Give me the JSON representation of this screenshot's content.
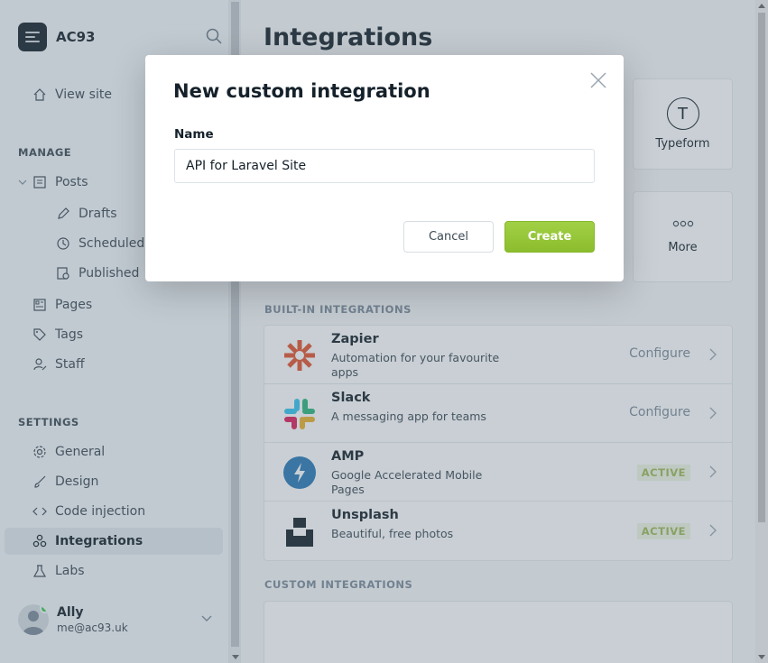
{
  "brand": {
    "name": "AC93"
  },
  "sidebar": {
    "view_site": "View site",
    "manage_label": "MANAGE",
    "posts": "Posts",
    "drafts": "Drafts",
    "scheduled": "Scheduled",
    "published": "Published",
    "pages": "Pages",
    "tags": "Tags",
    "staff": "Staff",
    "settings_label": "SETTINGS",
    "general": "General",
    "design": "Design",
    "code_injection": "Code injection",
    "integrations": "Integrations",
    "labs": "Labs"
  },
  "user": {
    "name": "Ally",
    "email": "me@ac93.uk"
  },
  "main": {
    "title": "Integrations",
    "tiles": {
      "typeform_letter": "T",
      "typeform": "Typeform",
      "more": "More"
    },
    "builtin_label": "BUILT-IN INTEGRATIONS",
    "custom_label": "CUSTOM INTEGRATIONS",
    "integrations": [
      {
        "name": "Zapier",
        "desc": "Automation for your favourite apps",
        "action": "Configure"
      },
      {
        "name": "Slack",
        "desc": "A messaging app for teams",
        "action": "Configure"
      },
      {
        "name": "AMP",
        "desc": "Google Accelerated Mobile Pages",
        "badge": "ACTIVE"
      },
      {
        "name": "Unsplash",
        "desc": "Beautiful, free photos",
        "badge": "ACTIVE"
      }
    ]
  },
  "modal": {
    "title": "New custom integration",
    "name_label": "Name",
    "name_value": "API for Laravel Site",
    "cancel": "Cancel",
    "create": "Create"
  },
  "colors": {
    "accent_green": "#9fca41",
    "zapier_orange": "#e5542f",
    "amp_blue": "#2a7ab8",
    "active_badge": "#9fbb58"
  }
}
